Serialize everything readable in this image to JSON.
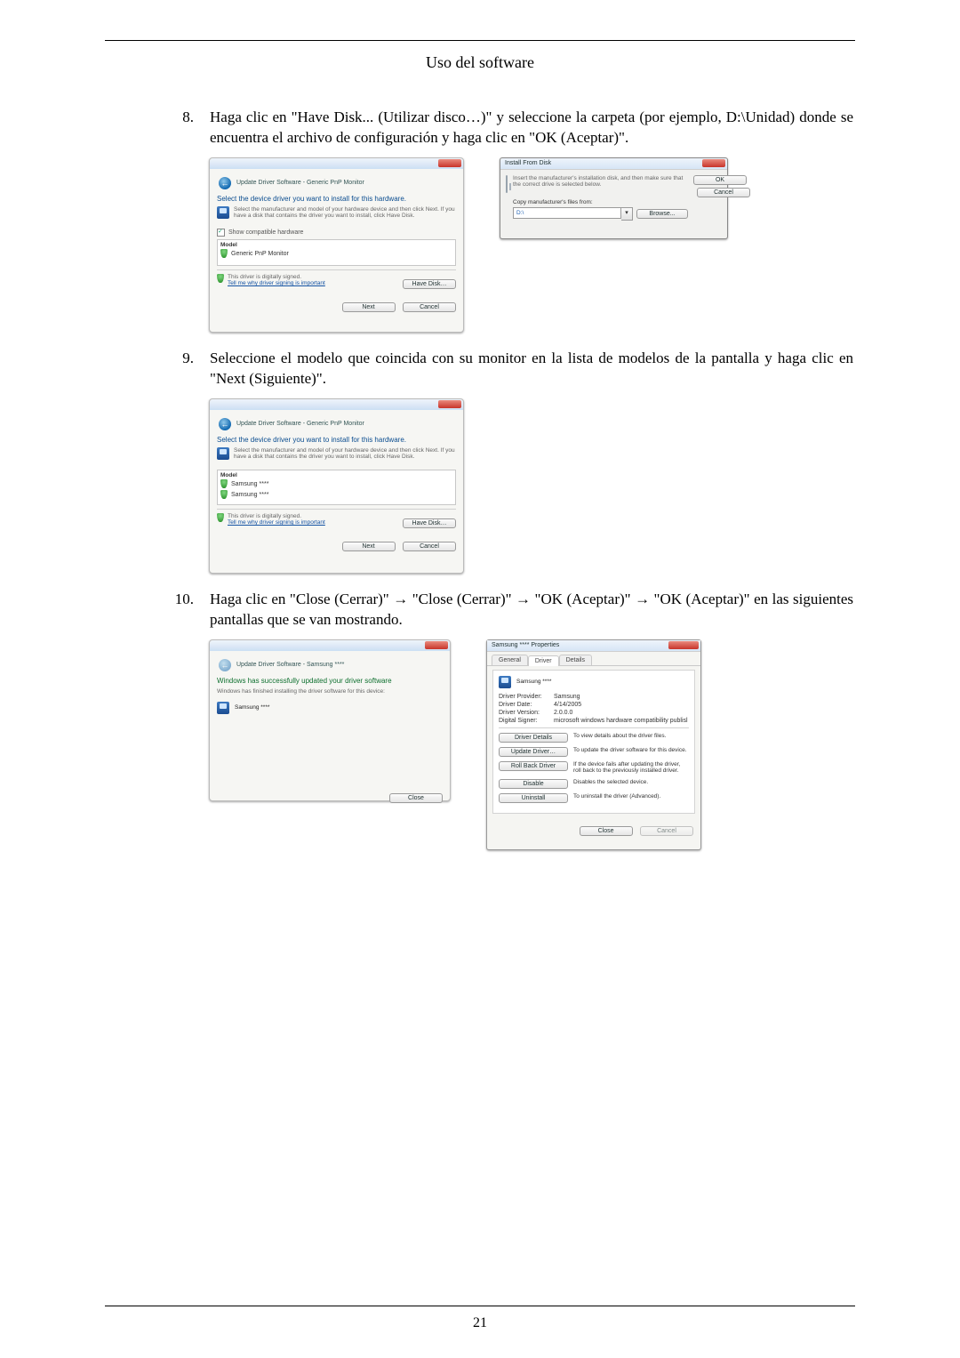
{
  "header": {
    "title": "Uso del software"
  },
  "footer": {
    "page": "21"
  },
  "steps": {
    "s8": {
      "num": "8.",
      "text": "Haga clic en \"Have Disk... (Utilizar disco…)\" y seleccione la carpeta (por ejemplo, D:\\Unidad) donde se encuentra el archivo de configuración y haga clic en \"OK (Aceptar)\"."
    },
    "s9": {
      "num": "9.",
      "text": "Seleccione el modelo que coincida con su monitor en la lista de modelos de la pantalla y haga clic en \"Next (Siguiente)\"."
    },
    "s10": {
      "num": "10.",
      "text": "Haga clic en \"Close (Cerrar)\"  →  \"Close (Cerrar)\"  →  \"OK (Aceptar)\"  →  \"OK (Aceptar)\" en las siguientes pantallas que se van mostrando."
    }
  },
  "wizard_select": {
    "crumb": "Update Driver Software - Generic PnP Monitor",
    "title": "Select the device driver you want to install for this hardware.",
    "hint": "Select the manufacturer and model of your hardware device and then click Next. If you have a disk that contains the driver you want to install, click Have Disk.",
    "check_label": "Show compatible hardware",
    "model_header": "Model",
    "model_item": "Generic PnP Monitor",
    "signed": "This driver is digitally signed.",
    "signed_link": "Tell me why driver signing is important",
    "btn_havedisk": "Have Disk…",
    "btn_next": "Next",
    "btn_cancel": "Cancel"
  },
  "install_from_disk": {
    "title": "Install From Disk",
    "msg": "Insert the manufacturer's installation disk, and then make sure that the correct drive is selected below.",
    "copy_label": "Copy manufacturer's files from:",
    "path": "D:\\",
    "btn_ok": "OK",
    "btn_cancel": "Cancel",
    "btn_browse": "Browse..."
  },
  "wizard_model": {
    "crumb": "Update Driver Software - Generic PnP Monitor",
    "title": "Select the device driver you want to install for this hardware.",
    "hint": "Select the manufacturer and model of your hardware device and then click Next. If you have a disk that contains the driver you want to install, click Have Disk.",
    "model_header": "Model",
    "m1": "Samsung ****",
    "m2": "Samsung ****",
    "signed": "This driver is digitally signed.",
    "signed_link": "Tell me why driver signing is important",
    "btn_havedisk": "Have Disk…",
    "btn_next": "Next",
    "btn_cancel": "Cancel"
  },
  "wizard_done": {
    "crumb": "Update Driver Software - Samsung ****",
    "title": "Windows has successfully updated your driver software",
    "sub": "Windows has finished installing the driver software for this device:",
    "device": "Samsung ****",
    "btn_close": "Close"
  },
  "props": {
    "title": "Samsung **** Properties",
    "tab_general": "General",
    "tab_driver": "Driver",
    "tab_details": "Details",
    "device": "Samsung ****",
    "provider_k": "Driver Provider:",
    "provider_v": "Samsung",
    "date_k": "Driver Date:",
    "date_v": "4/14/2005",
    "version_k": "Driver Version:",
    "version_v": "2.0.0.0",
    "signer_k": "Digital Signer:",
    "signer_v": "microsoft windows hardware compatibility publisl",
    "btn_details": "Driver Details",
    "desc_details": "To view details about the driver files.",
    "btn_update": "Update Driver…",
    "desc_update": "To update the driver software for this device.",
    "btn_rollback": "Roll Back Driver",
    "desc_rollback": "If the device fails after updating the driver, roll back to the previously installed driver.",
    "btn_disable": "Disable",
    "desc_disable": "Disables the selected device.",
    "btn_uninstall": "Uninstall",
    "desc_uninstall": "To uninstall the driver (Advanced).",
    "btn_close": "Close",
    "btn_cancel": "Cancel"
  }
}
